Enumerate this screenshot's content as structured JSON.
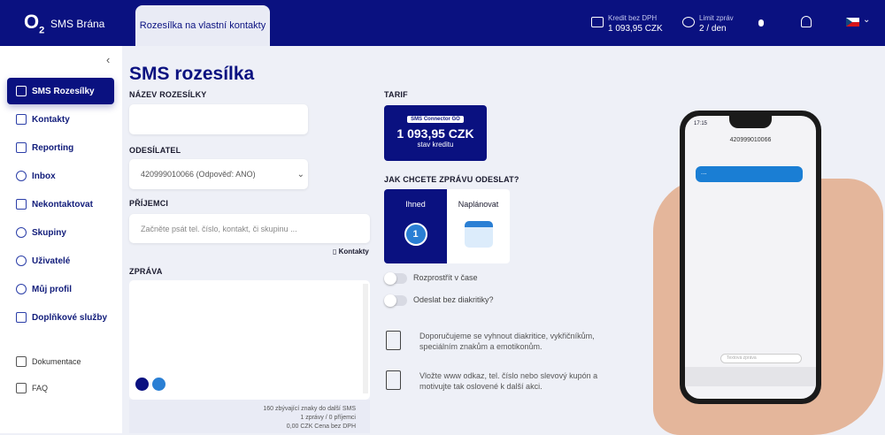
{
  "header": {
    "logo": "O",
    "logo_sub": "2",
    "brand": "SMS Brána",
    "tab": "Rozesílka na vlastní kontakty",
    "credit_label": "Kredit bez DPH",
    "credit_value": "1 093,95 CZK",
    "limit_label": "Limit zpráv",
    "limit_value": "2 / den"
  },
  "sidebar": {
    "items": [
      {
        "label": "SMS Rozesílky"
      },
      {
        "label": "Kontakty"
      },
      {
        "label": "Reporting"
      },
      {
        "label": "Inbox"
      },
      {
        "label": "Nekontaktovat"
      },
      {
        "label": "Skupiny"
      },
      {
        "label": "Uživatelé"
      },
      {
        "label": "Můj profil"
      },
      {
        "label": "Doplňkové služby"
      },
      {
        "label": "Dokumentace"
      },
      {
        "label": "FAQ"
      }
    ]
  },
  "main": {
    "title": "SMS rozesílka",
    "name_label": "NÁZEV ROZESÍLKY",
    "sender_label": "ODESÍLATEL",
    "sender_value": "420999010066 (Odpověď: ANO)",
    "recipients_label": "PŘÍJEMCI",
    "recipients_placeholder": "Začněte psát tel. číslo, kontakt, či skupinu ...",
    "contacts_link": "Kontakty",
    "message_label": "ZPRÁVA",
    "footer_line1": "160 zbývající znaky do další SMS",
    "footer_line2": "1 zprávy / 0 příjemci",
    "footer_line3": "0,00 CZK Cena bez DPH"
  },
  "tarif": {
    "label": "TARIF",
    "badge": "SMS Connector GO",
    "amount": "1 093,95 CZK",
    "sub": "stav kreditu"
  },
  "send": {
    "label": "JAK CHCETE ZPRÁVU ODESLAT?",
    "now": "Ihned",
    "now_num": "1",
    "scheduled": "Naplánovat",
    "spread": "Rozprostřít v čase",
    "no_diacritics": "Odeslat bez diakritiky?"
  },
  "tips": [
    "Doporučujeme se vyhnout diakritice, vykřičníkům, speciálním znakům a emotikonům.",
    "Vložte www odkaz, tel. číslo nebo slevový kupón a motivujte tak oslovené k další akci."
  ],
  "phone": {
    "time": "17:15",
    "number": "420999010066",
    "bubble": "...",
    "input_placeholder": "Textová zpráva"
  },
  "colors": {
    "brand": "#0a1180",
    "background": "#eef0f7"
  }
}
